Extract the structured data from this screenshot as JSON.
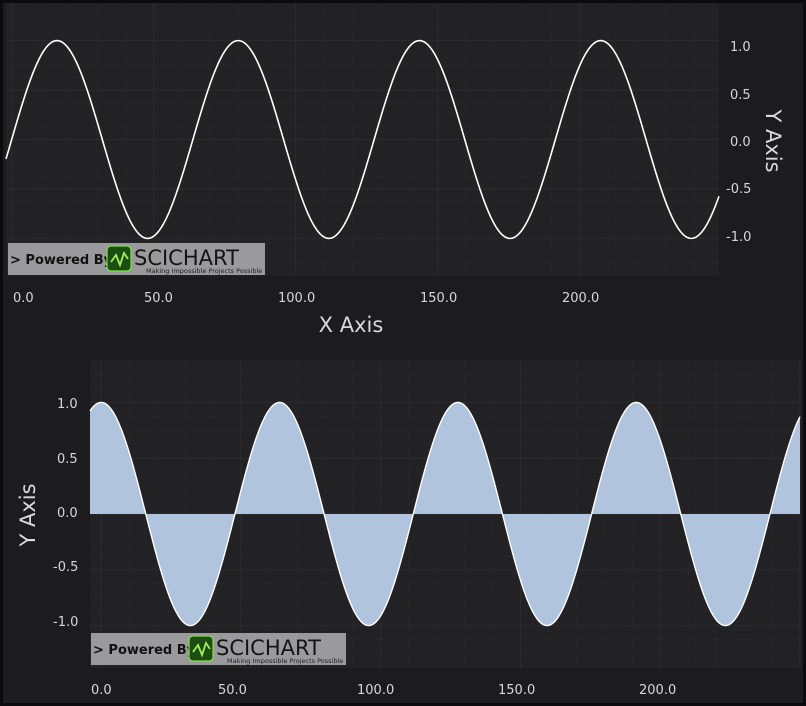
{
  "chart_data": [
    {
      "type": "line",
      "function": "sin",
      "xlabel": "X Axis",
      "ylabel": "Y Axis",
      "xlim": [
        -2,
        249
      ],
      "ylim": [
        -1.38,
        1.38
      ],
      "period": 63.8,
      "phase_deg": 0,
      "x_ticks": [
        "0.0",
        "50.0",
        "100.0",
        "150.0",
        "200.0"
      ],
      "y_ticks": [
        "1.0",
        "0.5",
        "0.0",
        "-0.5",
        "-1.0"
      ],
      "x_axis_position": "bottom",
      "y_axis_position": "right",
      "series": [
        {
          "x": [
            0,
            8,
            16,
            24,
            32,
            40,
            48,
            56,
            64,
            72,
            80,
            88,
            96,
            104,
            112,
            120,
            128,
            136,
            144,
            152,
            160,
            168,
            176,
            184,
            192,
            200,
            208,
            216,
            224,
            232,
            240,
            248
          ],
          "y": [
            0.0,
            0.71,
            1.0,
            0.71,
            0.0,
            -0.71,
            -1.0,
            -0.71,
            0.0,
            0.71,
            1.0,
            0.71,
            0.0,
            -0.71,
            -1.0,
            -0.71,
            0.0,
            0.71,
            1.0,
            0.71,
            0.0,
            -0.71,
            -1.0,
            -0.71,
            0.0,
            0.71,
            1.0,
            0.71,
            0.0,
            -0.71,
            -1.0,
            -0.71
          ],
          "color": "#ffffff"
        }
      ],
      "grid": true,
      "colors": {
        "background": "#1c1c1e",
        "line": "#ffffff",
        "grid": "#2c2c30"
      }
    },
    {
      "type": "area",
      "function": "sin",
      "ylabel": "Y Axis",
      "xlim": [
        -4,
        250
      ],
      "ylim": [
        -1.38,
        1.38
      ],
      "period": 63.8,
      "phase_deg": 90,
      "x_ticks": [
        "0.0",
        "50.0",
        "100.0",
        "150.0",
        "200.0"
      ],
      "y_ticks": [
        "1.0",
        "0.5",
        "0.0",
        "-0.5",
        "-1.0"
      ],
      "x_axis_position": "bottom",
      "y_axis_position": "left",
      "series": [
        {
          "x": [
            0,
            8,
            16,
            24,
            32,
            40,
            48,
            56,
            64,
            72,
            80,
            88,
            96,
            104,
            112,
            120,
            128,
            136,
            144,
            152,
            160,
            168,
            176,
            184,
            192,
            200,
            208,
            216,
            224,
            232,
            240,
            248
          ],
          "y": [
            1.0,
            0.71,
            0.0,
            -0.71,
            -1.0,
            -0.71,
            0.0,
            0.71,
            1.0,
            0.71,
            0.0,
            -0.71,
            -1.0,
            -0.71,
            0.0,
            0.71,
            1.0,
            0.71,
            0.0,
            -0.71,
            -1.0,
            -0.71,
            0.0,
            0.71,
            1.0,
            0.71,
            0.0,
            -0.71,
            -1.0,
            -0.71,
            0.0,
            0.71
          ],
          "color": "#b0c4de"
        }
      ],
      "grid": true,
      "colors": {
        "background": "#1c1c1e",
        "fill": "#b0c4de",
        "line": "#ffffff",
        "grid": "#2c2c30"
      }
    }
  ],
  "badges": [
    {
      "powered_label": "> Powered By",
      "brand": "SCICHART",
      "tagline": "Making Impossible Projects Possible"
    },
    {
      "powered_label": "> Powered By",
      "brand": "SCICHART",
      "tagline": "Making Impossible Projects Possible"
    }
  ]
}
